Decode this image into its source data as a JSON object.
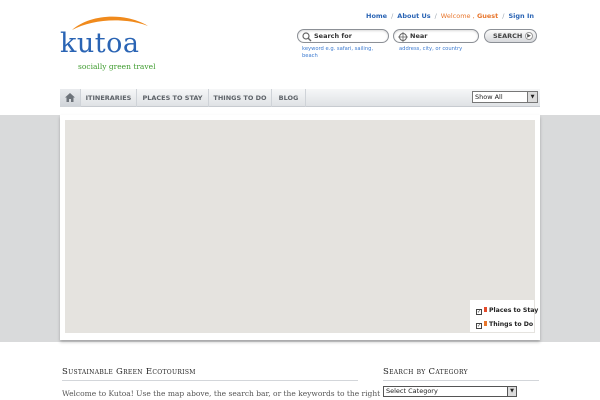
{
  "brand": {
    "name": "kutoa",
    "tagline": "socially green travel",
    "colors": {
      "blue": "#2a64b4",
      "orange": "#f08a1c",
      "green": "#3f9c2f"
    }
  },
  "toplinks": {
    "home": "Home",
    "about": "About Us",
    "welcome": "Welcome ,",
    "guest": "Guest",
    "signin": "Sign In"
  },
  "search": {
    "for_placeholder": "Search for",
    "for_hint": "keyword e.g. safari, sailing, beach",
    "near_placeholder": "Near",
    "near_hint": "address, city, or country",
    "button": "SEARCH"
  },
  "nav": {
    "home_icon": "home-icon",
    "items": [
      "ITINERARIES",
      "PLACES TO STAY",
      "THINGS TO DO",
      "BLOG"
    ],
    "filter": {
      "selected": "Show All"
    }
  },
  "map": {
    "legend": [
      {
        "label": "Places to Stay",
        "checked": true,
        "color": "#e44b2b"
      },
      {
        "label": "Things to Do",
        "checked": true,
        "color": "#e8772e"
      }
    ]
  },
  "content": {
    "main_heading": "Sustainable Green Ecotourism",
    "intro": "Welcome to Kutoa! Use the map above, the search bar, or the keywords to the right",
    "side_heading": "Search by Category",
    "category_select": "Select Category"
  }
}
